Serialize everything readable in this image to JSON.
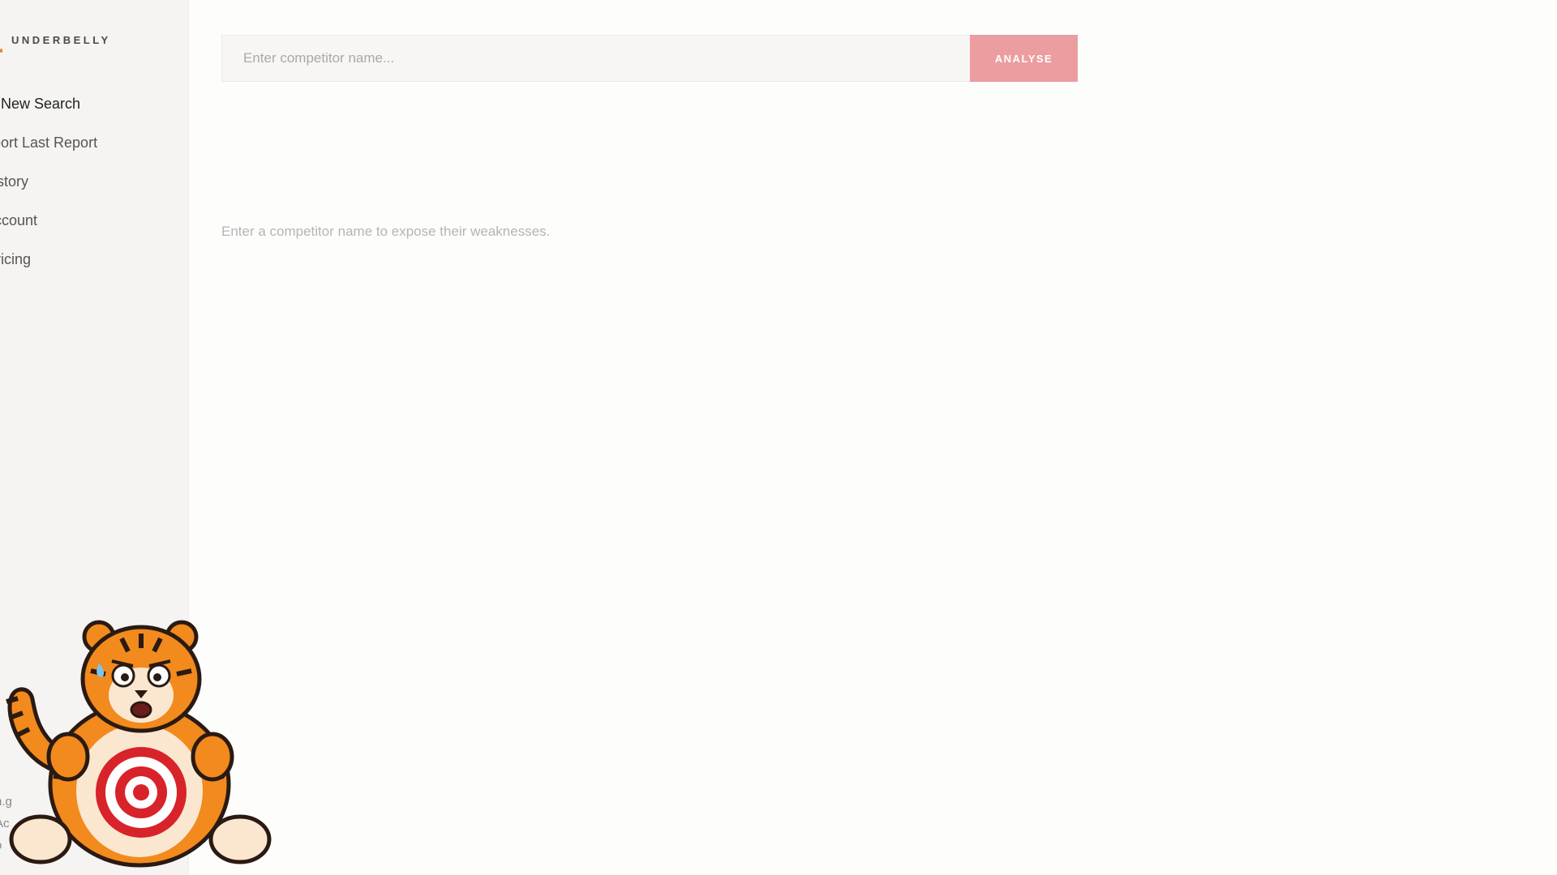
{
  "sidebar": {
    "brand": "UNDERBELLY",
    "nav": {
      "new_search": "New Search",
      "export_last_report": "xport Last Report",
      "history": "istory",
      "account": "ccount",
      "pricing": "ricing"
    },
    "footer_fragments": [
      "n.g",
      "Ac",
      "o"
    ]
  },
  "search": {
    "placeholder": "Enter competitor name...",
    "button_label": "ANALYSE"
  },
  "main": {
    "hint": "Enter a competitor name to expose their weaknesses."
  },
  "mascot": {
    "description_icon": "scared-tiger-with-target-icon",
    "colors": {
      "fur": "#f28a1e",
      "stripes": "#2a1a12",
      "belly": "#fbe7cf",
      "target_red": "#d8232a"
    }
  },
  "colors": {
    "accent": "#eb9da0",
    "sidebar_bg": "#f5f4f2",
    "page_bg": "#fdfdfc"
  }
}
